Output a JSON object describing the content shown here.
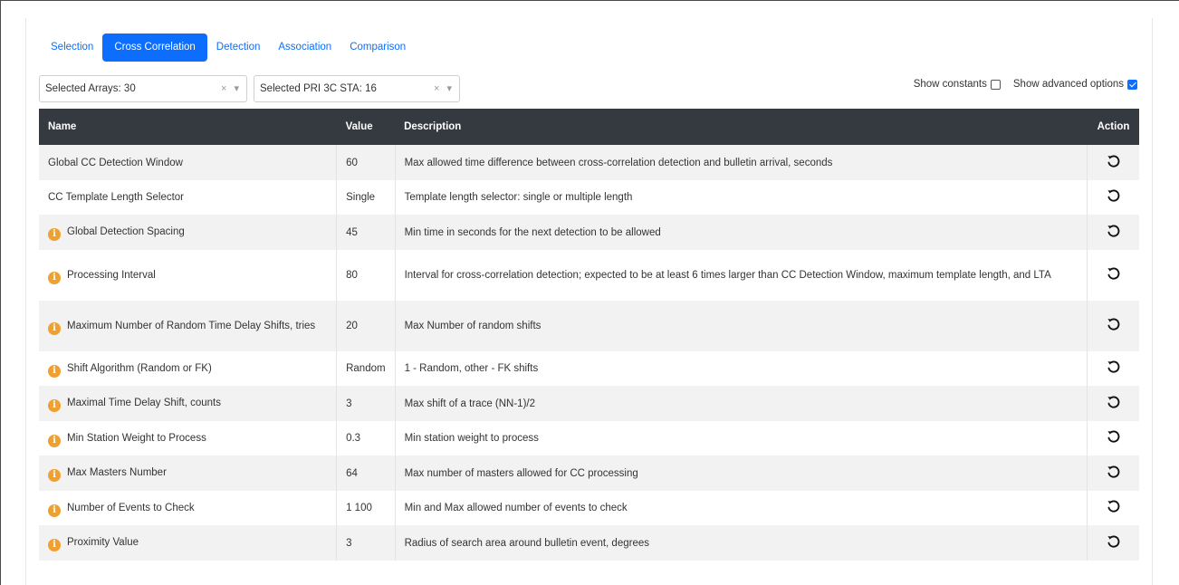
{
  "tabs": [
    {
      "label": "Selection",
      "active": false
    },
    {
      "label": "Cross Correlation",
      "active": true
    },
    {
      "label": "Detection",
      "active": false
    },
    {
      "label": "Association",
      "active": false
    },
    {
      "label": "Comparison",
      "active": false
    }
  ],
  "selects": {
    "arrays": {
      "value": "Selected Arrays: 30",
      "clear": "×",
      "arrow": "▾"
    },
    "stations": {
      "value": "Selected PRI 3C STA: 16",
      "clear": "×",
      "arrow": "▾"
    }
  },
  "options": {
    "show_constants": {
      "label": "Show constants",
      "checked": false
    },
    "show_advanced": {
      "label": "Show advanced options",
      "checked": true
    }
  },
  "table": {
    "headers": {
      "name": "Name",
      "value": "Value",
      "description": "Description",
      "action": "Action"
    },
    "rows": [
      {
        "name": "Global CC Detection Window",
        "info": false,
        "value": "60",
        "description": "Max allowed time difference between cross-correlation detection and bulletin arrival, seconds"
      },
      {
        "name": "CC Template Length Selector",
        "info": false,
        "value": "Single",
        "description": "Template length selector: single or multiple length"
      },
      {
        "name": "Global Detection Spacing",
        "info": true,
        "value": "45",
        "description": "Min time in seconds for the next detection to be allowed"
      },
      {
        "name": "Processing Interval",
        "info": true,
        "value": "80",
        "description": "Interval for cross-correlation detection; expected to be at least 6 times larger than CC Detection Window, maximum template length, and LTA"
      },
      {
        "name": "Maximum Number of Random Time Delay Shifts, tries",
        "info": true,
        "value": "20",
        "description": "Max Number of random shifts"
      },
      {
        "name": "Shift Algorithm (Random or FK)",
        "info": true,
        "value": "Random",
        "description": "1 - Random, other - FK shifts"
      },
      {
        "name": "Maximal Time Delay Shift, counts",
        "info": true,
        "value": "3",
        "description": "Max shift of a trace (NN-1)/2"
      },
      {
        "name": "Min Station Weight to Process",
        "info": true,
        "value": "0.3",
        "description": "Min station weight to process"
      },
      {
        "name": "Max Masters Number",
        "info": true,
        "value": "64",
        "description": "Max number of masters allowed for CC processing"
      },
      {
        "name": "Number of Events to Check",
        "info": true,
        "value": "1 100",
        "description": "Min and Max allowed number of events to check"
      },
      {
        "name": "Proximity Value",
        "info": true,
        "value": "3",
        "description": "Radius of search area around bulletin event, degrees"
      }
    ]
  },
  "icons": {
    "info": "info-icon",
    "undo": "undo-icon"
  },
  "colors": {
    "accent": "#0d6efd",
    "header_bg": "#343a40",
    "info_badge": "#f0a030"
  }
}
